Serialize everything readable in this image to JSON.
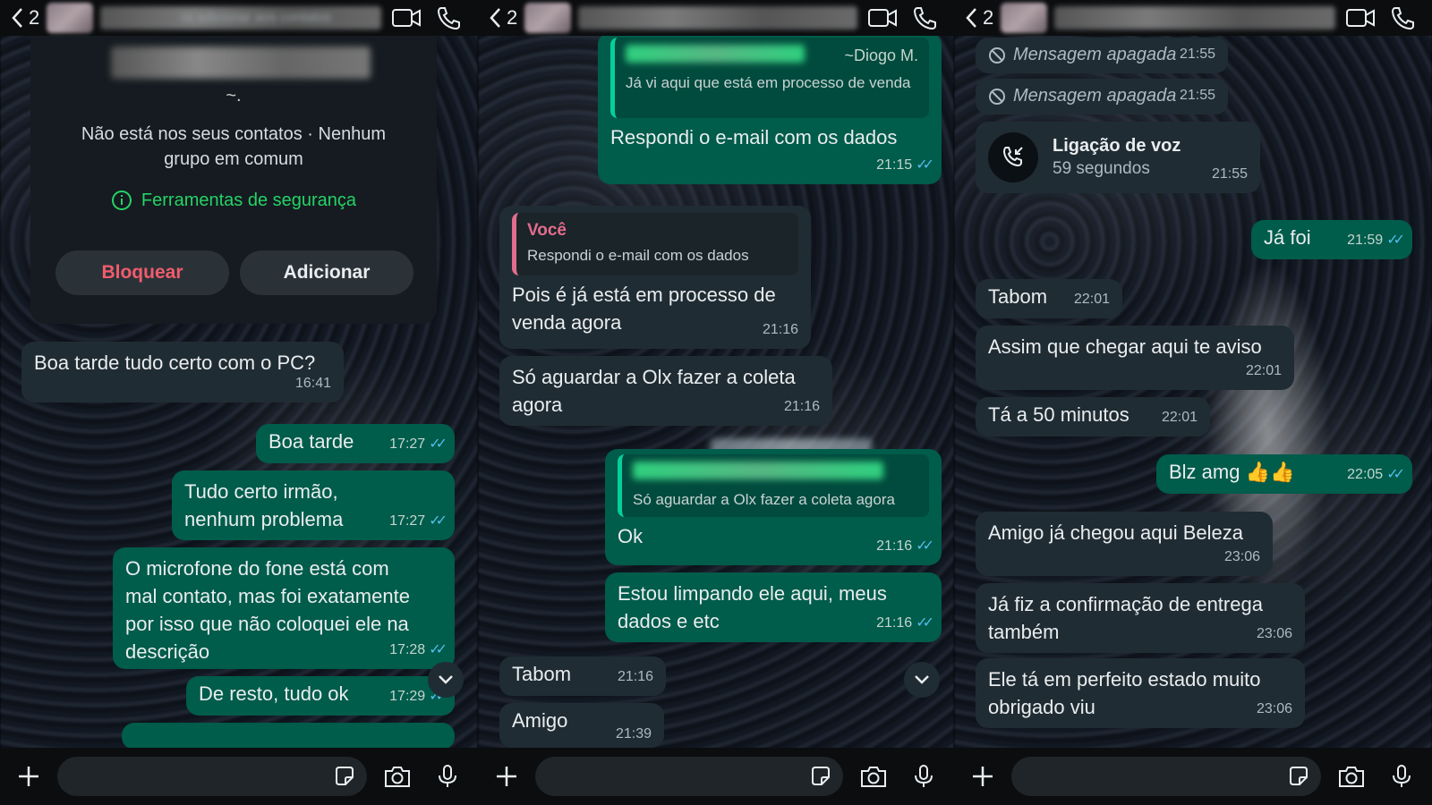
{
  "colors": {
    "incoming": "#202c33",
    "outgoing": "#005c4b",
    "read_tick": "#53bdeb",
    "block": "#f15c6d",
    "safety": "#25d366"
  },
  "panels": [
    {
      "header": {
        "back_count": "2",
        "subtitle": "ra adicionar aos contatos"
      },
      "card": {
        "tilde": "~.",
        "info": "Não está nos seus contatos · Nenhum grupo em comum",
        "safety": "Ferramentas de segurança",
        "block": "Bloquear",
        "add": "Adicionar"
      },
      "messages": [
        {
          "text": "Boa tarde tudo certo com o PC?",
          "time": "16:41"
        },
        {
          "text": "Boa tarde",
          "time": "17:27"
        },
        {
          "text": "Tudo certo irmão, nenhum problema",
          "time": "17:27"
        },
        {
          "text": "O microfone do fone está com mal contato, mas foi exatamente por isso que não coloquei ele na descrição",
          "time": "17:28"
        },
        {
          "text": "De resto, tudo ok",
          "time": "17:29"
        }
      ]
    },
    {
      "header": {
        "back_count": "2"
      },
      "messages": [
        {
          "quote_author": "~Diogo M.",
          "quote_text": "Já vi aqui que está em processo de venda",
          "text": "Respondi o e-mail com os dados",
          "time": "21:15"
        },
        {
          "quote_author": "Você",
          "quote_text": "Respondi o e-mail com os dados",
          "text": "Pois é já está em processo de venda agora",
          "time": "21:16"
        },
        {
          "text": "Só aguardar a Olx fazer a coleta agora",
          "time": "21:16"
        },
        {
          "quote_text": "Só aguardar a Olx fazer a coleta agora",
          "text": "Ok",
          "time": "21:16"
        },
        {
          "text": "Estou limpando ele aqui, meus dados e etc",
          "time": "21:16"
        },
        {
          "text": "Tabom",
          "time": "21:16"
        },
        {
          "text": "Amigo",
          "time": "21:39"
        }
      ]
    },
    {
      "header": {
        "back_count": "2"
      },
      "messages": [
        {
          "text": "Mensagem apagada",
          "time": "21:55"
        },
        {
          "text": "Mensagem apagada",
          "time": "21:55"
        },
        {
          "call_title": "Ligação de voz",
          "call_duration": "59 segundos",
          "time": "21:55"
        },
        {
          "text": "Já foi",
          "time": "21:59"
        },
        {
          "text": "Tabom",
          "time": "22:01"
        },
        {
          "text": "Assim que chegar aqui te aviso",
          "time": "22:01"
        },
        {
          "text": "Tá a 50 minutos",
          "time": "22:01"
        },
        {
          "text": "Blz amg 👍👍",
          "time": "22:05"
        },
        {
          "text": "Amigo já chegou aqui Beleza",
          "time": "23:06"
        },
        {
          "text": "Já fiz a confirmação de entrega também",
          "time": "23:06"
        },
        {
          "text": "Ele tá em perfeito estado muito obrigado viu",
          "time": "23:06"
        }
      ]
    }
  ]
}
